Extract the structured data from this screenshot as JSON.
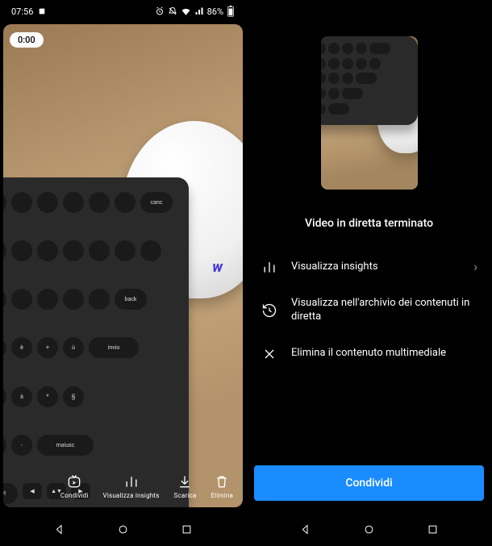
{
  "status": {
    "time": "07:56",
    "battery_text": "86%"
  },
  "left": {
    "timer": "0:00",
    "toolbar": {
      "share": "Condividi",
      "insights": "Visualizza insights",
      "download": "Scarica",
      "delete": "Elimina"
    }
  },
  "right": {
    "title": "Video in diretta terminato",
    "items": {
      "insights": "Visualizza insights",
      "archive": "Visualizza nell'archivio dei contenuti in diretta",
      "delete": "Elimina il contenuto multimediale"
    },
    "share_button": "Condividi"
  }
}
